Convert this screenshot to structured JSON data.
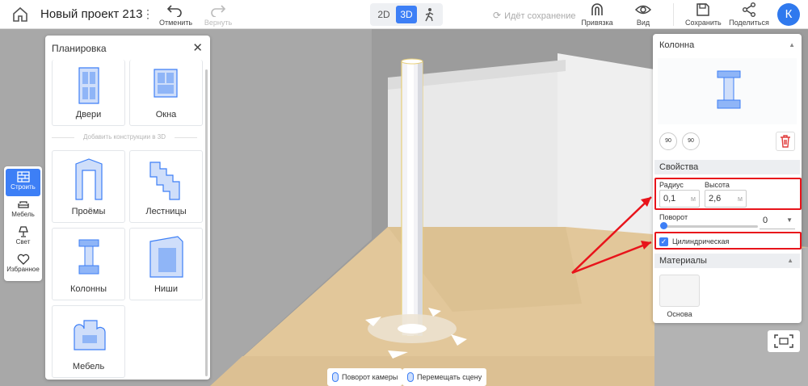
{
  "topbar": {
    "project_title": "Новый проект 213",
    "kebab": "⋮",
    "undo_label": "Отменить",
    "redo_label": "Вернуть",
    "view_2d": "2D",
    "view_3d": "3D",
    "saving_status": "Идёт сохранение",
    "snap_label": "Привязка",
    "view_label": "Вид",
    "save_label": "Сохранить",
    "share_label": "Поделиться",
    "avatar_letter": "К"
  },
  "toolstrip": [
    {
      "label": "Строить",
      "icon": "brick-icon",
      "active": true
    },
    {
      "label": "Мебель",
      "icon": "sofa-icon",
      "active": false
    },
    {
      "label": "Свет",
      "icon": "lamp-icon",
      "active": false
    },
    {
      "label": "Избранное",
      "icon": "heart-icon",
      "active": false
    }
  ],
  "planning": {
    "title": "Планировка",
    "close": "✕",
    "top_items": [
      {
        "label": "Двери",
        "icon": "door-icon"
      },
      {
        "label": "Окна",
        "icon": "window-icon"
      }
    ],
    "divider": "Добавить конструкции в 3D",
    "items": [
      {
        "label": "Проёмы",
        "icon": "opening-icon"
      },
      {
        "label": "Лестницы",
        "icon": "stairs-icon"
      },
      {
        "label": "Колонны",
        "icon": "column-icon"
      },
      {
        "label": "Ниши",
        "icon": "niche-icon"
      },
      {
        "label": "Мебель",
        "icon": "armchair-icon"
      }
    ]
  },
  "properties": {
    "title": "Колонна",
    "rotate_left": "90",
    "rotate_right": "90",
    "section_props": "Свойства",
    "radius_label": "Радиус",
    "radius_value": "0,1",
    "height_label": "Высота",
    "height_value": "2,6",
    "unit": "м",
    "rotation_label": "Поворот",
    "rotation_value": "0",
    "rotation_slider": 0,
    "cylindrical_label": "Цилиндрическая",
    "cylindrical_checked": true,
    "section_materials": "Материалы",
    "material_label": "Основа"
  },
  "hints": {
    "rotate_camera": "Поворот камеры",
    "move_scene": "Перемещать сцену"
  },
  "colors": {
    "accent": "#3d7ff6",
    "highlight": "#e8141b",
    "floor": "#e2c79a"
  }
}
